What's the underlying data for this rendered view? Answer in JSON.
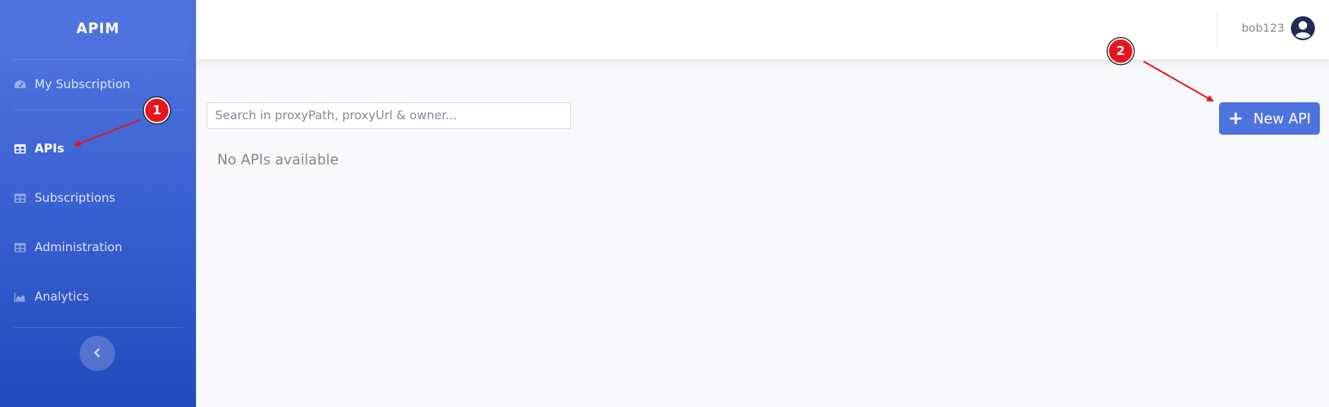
{
  "sidebar": {
    "brand": "APIM",
    "items": [
      {
        "label": "My Subscription",
        "icon": "tachometer-icon"
      },
      {
        "label": "APIs",
        "icon": "table-icon",
        "active": true
      },
      {
        "label": "Subscriptions",
        "icon": "table-icon"
      },
      {
        "label": "Administration",
        "icon": "table-icon"
      },
      {
        "label": "Analytics",
        "icon": "area-chart-icon"
      }
    ],
    "collapse_icon": "chevron-left-icon"
  },
  "topbar": {
    "username": "bob123",
    "avatar_icon": "user-circle-icon"
  },
  "main": {
    "search_placeholder": "Search in proxyPath, proxyUrl & owner...",
    "empty_message": "No APIs available",
    "new_api_label": "New API",
    "new_api_icon": "plus-icon"
  },
  "annotations": {
    "marker1": "1",
    "marker2": "2"
  },
  "colors": {
    "primary": "#4e73df",
    "sidebar_bottom": "#224abe",
    "annotation_red": "#e8141c"
  }
}
